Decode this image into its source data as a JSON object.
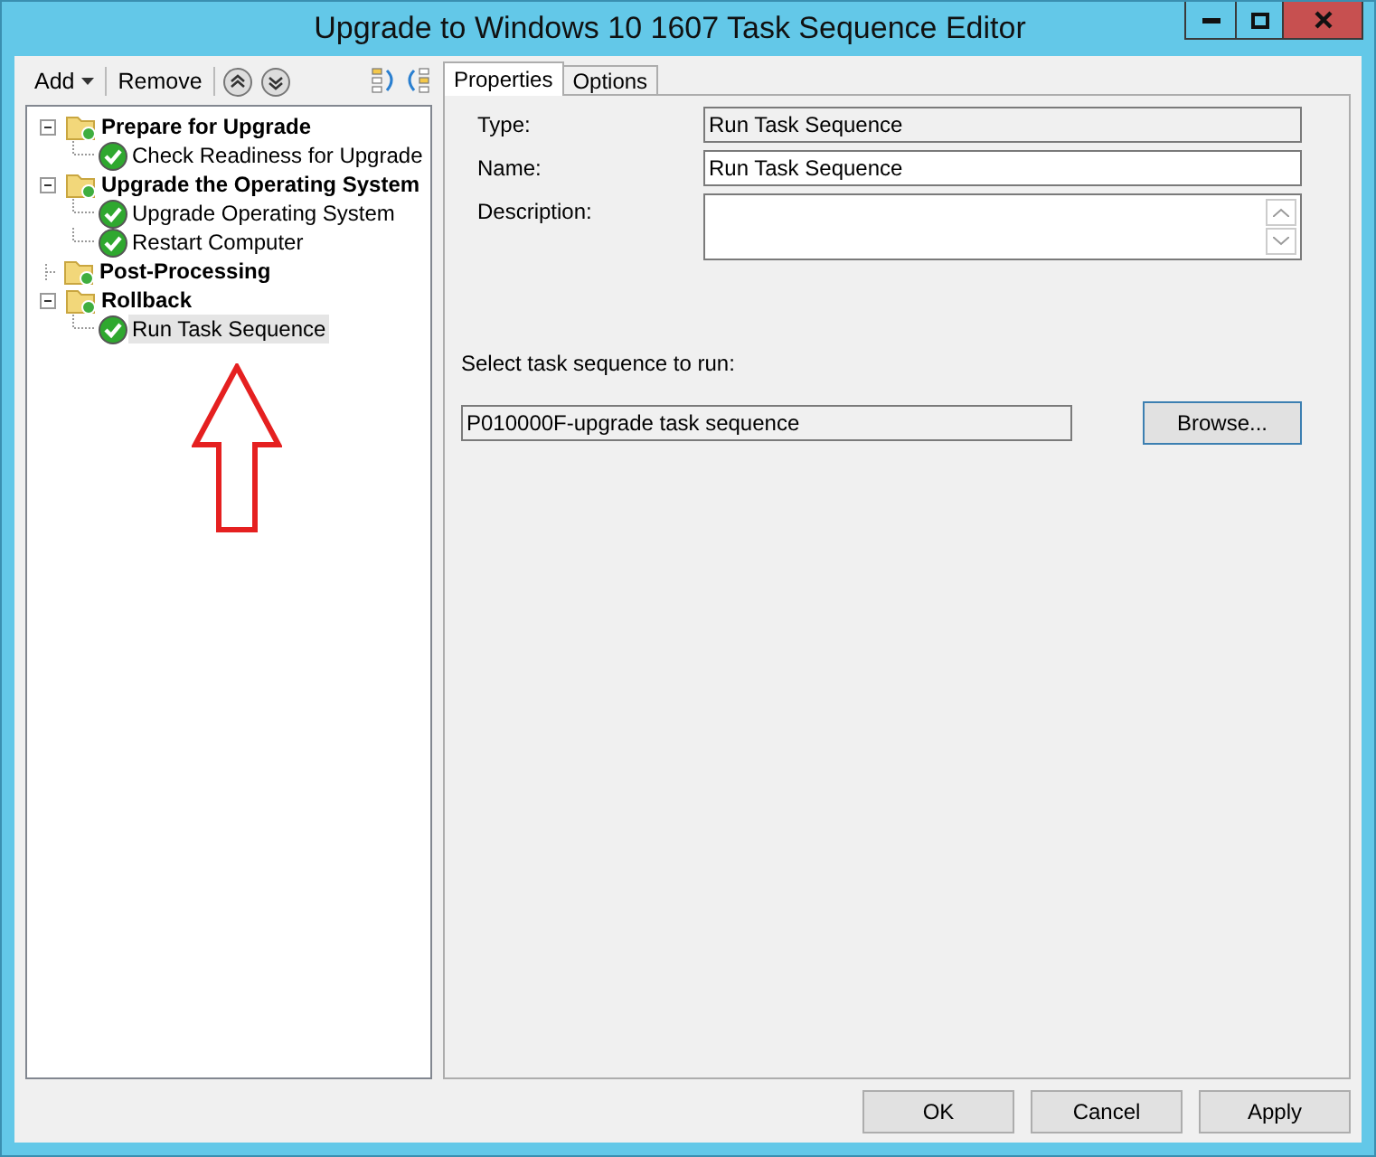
{
  "window": {
    "title": "Upgrade to Windows 10 1607 Task Sequence Editor"
  },
  "toolbar": {
    "add": "Add",
    "remove": "Remove"
  },
  "tree": [
    {
      "label": "Prepare for Upgrade",
      "kind": "group",
      "expanded": true,
      "selected": false,
      "children": [
        {
          "label": "Check Readiness for Upgrade",
          "kind": "step",
          "selected": false
        }
      ]
    },
    {
      "label": "Upgrade the Operating System",
      "kind": "group",
      "expanded": true,
      "selected": false,
      "children": [
        {
          "label": "Upgrade Operating System",
          "kind": "step",
          "selected": false
        },
        {
          "label": "Restart Computer",
          "kind": "step",
          "selected": false
        }
      ]
    },
    {
      "label": "Post-Processing",
      "kind": "group",
      "expanded": false,
      "selected": false
    },
    {
      "label": "Rollback",
      "kind": "group",
      "expanded": true,
      "selected": false,
      "children": [
        {
          "label": "Run Task Sequence",
          "kind": "step",
          "selected": true
        }
      ]
    }
  ],
  "tabs": [
    {
      "label": "Properties",
      "selected": true
    },
    {
      "label": "Options",
      "selected": false
    }
  ],
  "properties": {
    "type_label": "Type:",
    "type_value": "Run Task Sequence",
    "name_label": "Name:",
    "name_value": "Run Task Sequence",
    "description_label": "Description:",
    "select_label": "Select task sequence to run:",
    "sequence_value": "P010000F-upgrade task sequence",
    "browse": "Browse..."
  },
  "buttons": [
    "OK",
    "Cancel",
    "Apply"
  ]
}
